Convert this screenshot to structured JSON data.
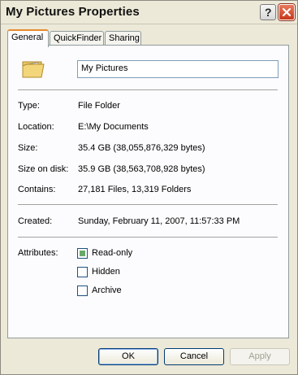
{
  "window": {
    "title": "My Pictures Properties",
    "help_symbol": "?"
  },
  "tabs": [
    {
      "label": "General",
      "active": true
    },
    {
      "label": "QuickFinder",
      "active": false
    },
    {
      "label": "Sharing",
      "active": false
    }
  ],
  "general": {
    "name_value": "My Pictures",
    "folder_icon": "folder-pictures-icon",
    "type_label": "Type:",
    "type_value": "File Folder",
    "location_label": "Location:",
    "location_value": "E:\\My Documents",
    "size_label": "Size:",
    "size_value": "35.4 GB (38,055,876,329 bytes)",
    "size_on_disk_label": "Size on disk:",
    "size_on_disk_value": "35.9 GB (38,563,708,928 bytes)",
    "contains_label": "Contains:",
    "contains_value": "27,181 Files, 13,319 Folders",
    "created_label": "Created:",
    "created_value": "Sunday, February 11, 2007, 11:57:33 PM",
    "attributes_label": "Attributes:",
    "attributes": [
      {
        "label": "Read-only",
        "checked": true
      },
      {
        "label": "Hidden",
        "checked": false
      },
      {
        "label": "Archive",
        "checked": false
      }
    ]
  },
  "buttons": {
    "ok": "OK",
    "cancel": "Cancel",
    "apply": "Apply"
  }
}
